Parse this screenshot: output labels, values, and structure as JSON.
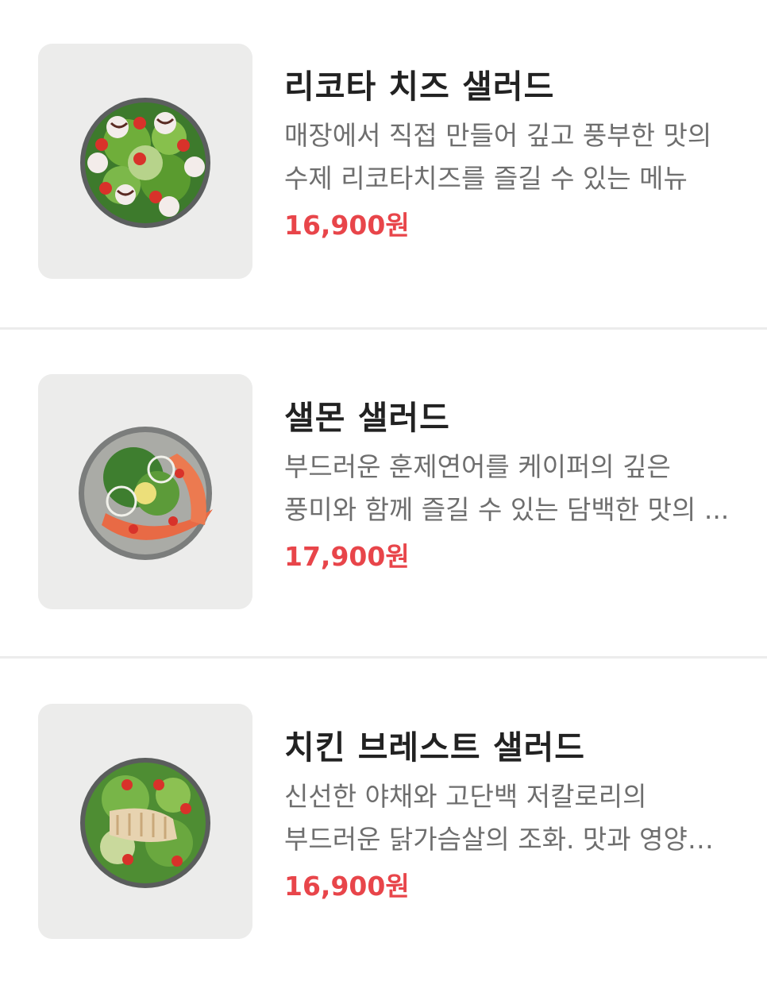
{
  "menu": {
    "items": [
      {
        "name": "리코타 치즈 샐러드",
        "description": "매장에서 직접 만들어 깊고 풍부한 맛의 수제 리코타치즈를 즐길 수 있는 메뉴",
        "price": "16,900원",
        "image_icon": "ricotta-salad-image"
      },
      {
        "name": "샐몬 샐러드",
        "description": "부드러운 훈제연어를 케이퍼의 깊은 풍미와 함께 즐길 수 있는 담백한 맛의 ...",
        "price": "17,900원",
        "image_icon": "salmon-salad-image"
      },
      {
        "name": "치킨 브레스트 샐러드",
        "description": "신선한 야채와 고단백 저칼로리의 부드러운 닭가슴살의 조화. 맛과 영양을 동...",
        "price": "16,900원",
        "image_icon": "chicken-salad-image"
      }
    ]
  },
  "colors": {
    "price": "#e8454a",
    "divider": "#ececec",
    "thumb_bg": "#ececeb"
  }
}
